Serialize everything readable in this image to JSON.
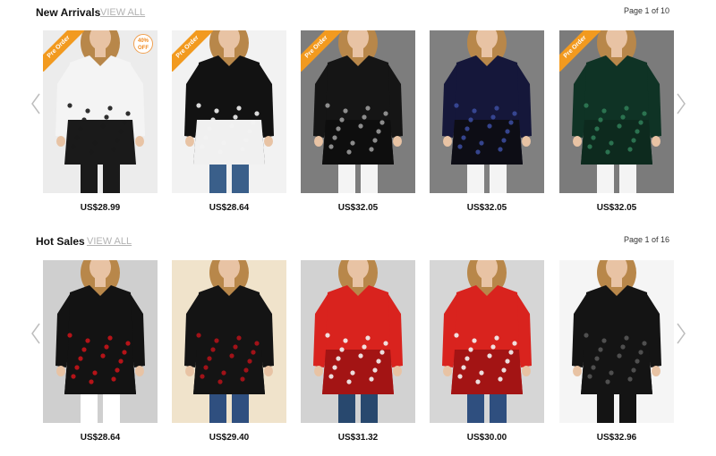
{
  "new_arrivals": {
    "title": "New Arrivals",
    "view_all": "VIEW ALL",
    "page_info": "Page 1 of 10",
    "products": [
      {
        "price": "US$28.99",
        "ribbon": "Pre Order",
        "discount_pct": "40%",
        "discount_word": "OFF",
        "bg": "#ececec",
        "top": "#f4f4f4",
        "pattern": "#1a1a1a",
        "bottom": "#1a1a1a",
        "legs": "#1a1a1a"
      },
      {
        "price": "US$28.64",
        "ribbon": "Pre Order",
        "bg": "#f2f2f2",
        "top": "#121212",
        "pattern": "#f2f2f2",
        "bottom": "#f0f0f0",
        "legs": "#3a5f8a"
      },
      {
        "price": "US$32.05",
        "ribbon": "Pre Order",
        "bg": "#7d7d7d",
        "top": "#151515",
        "pattern": "#9a9a9a",
        "bottom": "#0e0e0e",
        "legs": "#f4f4f4"
      },
      {
        "price": "US$32.05",
        "bg": "#808080",
        "top": "#15173a",
        "pattern": "#3a4a9a",
        "bottom": "#0d0d15",
        "legs": "#f4f4f4"
      },
      {
        "price": "US$32.05",
        "ribbon": "Pre Order",
        "bg": "#7b7b7b",
        "top": "#0f3325",
        "pattern": "#2f7a55",
        "bottom": "#0d2a1e",
        "legs": "#f4f4f4"
      }
    ]
  },
  "hot_sales": {
    "title": "Hot Sales",
    "view_all": "VIEW ALL",
    "page_info": "Page 1 of 16",
    "products": [
      {
        "price": "US$28.64",
        "bg": "#cfcfcf",
        "top": "#131313",
        "pattern": "#c8141a",
        "bottom": "#131313",
        "legs": "#ffffff"
      },
      {
        "price": "US$29.40",
        "bg": "#f0e3cb",
        "top": "#141414",
        "pattern": "#b01218",
        "bottom": "#141414",
        "legs": "#2f4f7f"
      },
      {
        "price": "US$31.32",
        "bg": "#d2d2d2",
        "top": "#d9231e",
        "pattern": "#f4f4f4",
        "bottom": "#a31414",
        "legs": "#28486e"
      },
      {
        "price": "US$30.00",
        "bg": "#d6d6d6",
        "top": "#d9231e",
        "pattern": "#f4f4f4",
        "bottom": "#a31414",
        "legs": "#2f4f7f"
      },
      {
        "price": "US$32.96",
        "bg": "#f5f5f5",
        "top": "#141414",
        "pattern": "#555555",
        "bottom": "#141414",
        "legs": "#141414"
      }
    ]
  }
}
